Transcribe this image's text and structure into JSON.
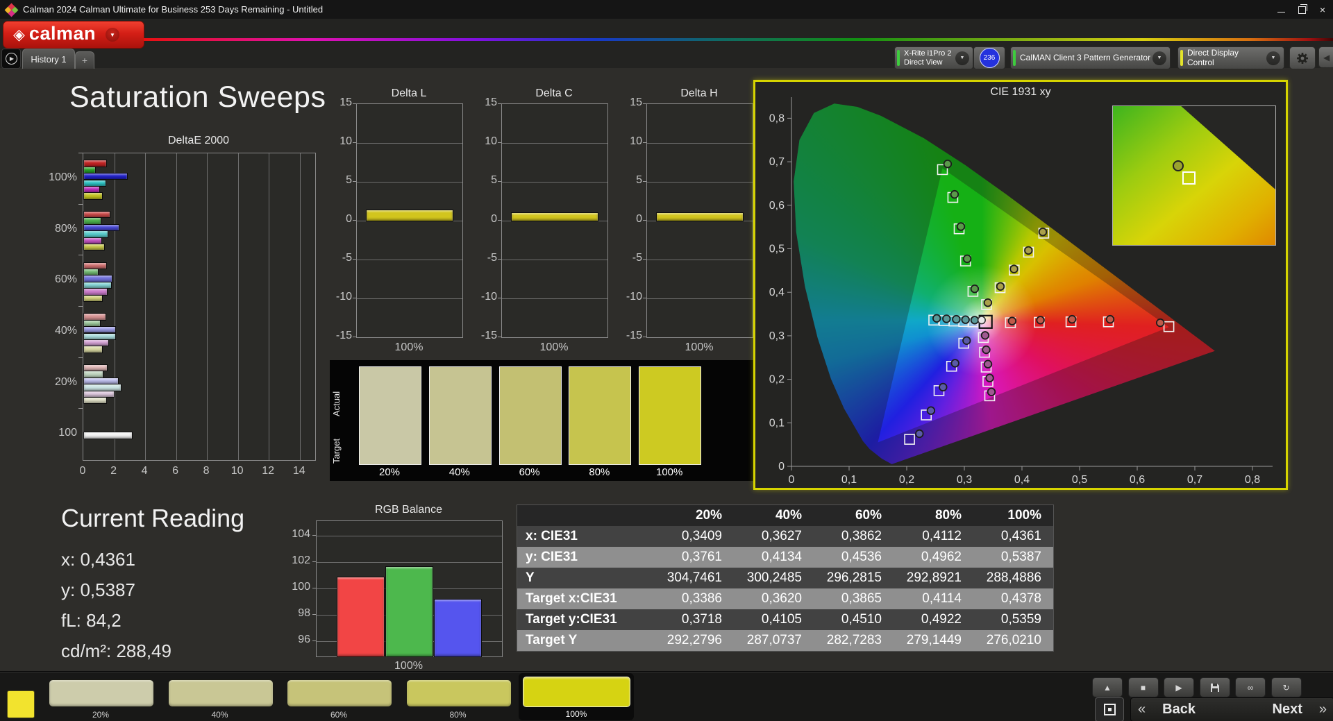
{
  "window": {
    "title": "Calman 2024 Calman Ultimate for Business 253 Days Remaining  - Untitled",
    "controls": {
      "minimize": "minimize",
      "restore": "restore",
      "close": "×"
    }
  },
  "header": {
    "logo_text": "calman",
    "logo_icon": "◈"
  },
  "tabs": {
    "items": [
      "History 1"
    ],
    "add_label": "+"
  },
  "toolbar": {
    "meter": {
      "line1": "X-Rite i1Pro 2",
      "line2": "Direct View",
      "badge": "236",
      "accent": "#3ecb3e",
      "badge_color": "#2431dd"
    },
    "pattern": {
      "label": "CalMAN Client 3 Pattern Generator",
      "accent": "#3ecb3e"
    },
    "display": {
      "label": "Direct Display Control",
      "accent": "#e3e32a"
    }
  },
  "page_title": "Saturation Sweeps",
  "charts": {
    "deltae": {
      "type": "bar",
      "title": "DeltaE 2000",
      "x_ticks": [
        0,
        2,
        4,
        6,
        8,
        10,
        12,
        14
      ],
      "x_max": 15,
      "groups": [
        {
          "label": "100%",
          "values": [
            1.42,
            0.7,
            2.8,
            1.39,
            0.97,
            1.15
          ],
          "colors": [
            "#c22424",
            "#28a428",
            "#2222cc",
            "#2cc4c4",
            "#bc2cbc",
            "#c2c220"
          ]
        },
        {
          "label": "80%",
          "values": [
            1.68,
            1.08,
            2.25,
            1.53,
            1.12,
            1.3
          ],
          "colors": [
            "#cc4949",
            "#4cb04c",
            "#4848d4",
            "#58cccc",
            "#c454c4",
            "#c8c84a"
          ]
        },
        {
          "label": "60%",
          "values": [
            1.42,
            0.9,
            1.8,
            1.77,
            1.47,
            1.15
          ],
          "colors": [
            "#d07070",
            "#74bc74",
            "#7272dc",
            "#84d4d4",
            "#cc7ccc",
            "#d0d078"
          ]
        },
        {
          "label": "40%",
          "values": [
            1.39,
            1.02,
            2.02,
            2.02,
            1.57,
            1.17
          ],
          "colors": [
            "#d89494",
            "#9cc89c",
            "#9a9ae4",
            "#aadcdc",
            "#d4a2d4",
            "#d8d8a2"
          ]
        },
        {
          "label": "20%",
          "values": [
            1.5,
            1.2,
            2.22,
            2.36,
            1.92,
            1.42
          ],
          "colors": [
            "#e0b6b6",
            "#bed4be",
            "#bcbcec",
            "#cce4e4",
            "#dcc6dc",
            "#e0e0c6"
          ]
        },
        {
          "label": "100",
          "values": [
            3.1
          ],
          "colors": [
            "#f2f2f2"
          ]
        }
      ]
    },
    "delta_lch": {
      "type": "bar",
      "ticks": [
        15,
        10,
        5,
        0,
        -5,
        -10,
        -15
      ],
      "range": [
        -15,
        15
      ],
      "x_label": "100%",
      "bar_color": "#d2c51e",
      "panels": [
        {
          "title": "Delta L",
          "value": 1.35
        },
        {
          "title": "Delta C",
          "value": 0.95
        },
        {
          "title": "Delta H",
          "value": 0.95
        }
      ]
    },
    "swatches": {
      "row_labels": [
        "Actual",
        "Target"
      ],
      "items": [
        {
          "label": "20%",
          "color": "#c9c8a6"
        },
        {
          "label": "40%",
          "color": "#c6c492"
        },
        {
          "label": "60%",
          "color": "#c3c072"
        },
        {
          "label": "80%",
          "color": "#c6c44e"
        },
        {
          "label": "100%",
          "color": "#cdca22"
        }
      ]
    },
    "cie": {
      "type": "scatter",
      "title": "CIE 1931 xy",
      "x_ticks": [
        "0",
        "0,1",
        "0,2",
        "0,3",
        "0,4",
        "0,5",
        "0,6",
        "0,7",
        "0,8"
      ],
      "y_ticks": [
        "0",
        "0,1",
        "0,2",
        "0,3",
        "0,4",
        "0,5",
        "0,6",
        "0,7",
        "0,8"
      ],
      "white_point": {
        "square": [
          0.337,
          0.332
        ],
        "circle": [
          0.33,
          0.336
        ]
      },
      "series": [
        {
          "name": "red",
          "dot_color": "#c05a4a",
          "measured": [
            [
              0.383,
              0.334
            ],
            [
              0.432,
              0.336
            ],
            [
              0.487,
              0.338
            ],
            [
              0.553,
              0.338
            ],
            [
              0.64,
              0.33
            ]
          ],
          "target": [
            [
              0.38,
              0.33
            ],
            [
              0.43,
              0.331
            ],
            [
              0.485,
              0.332
            ],
            [
              0.55,
              0.332
            ],
            [
              0.655,
              0.321
            ]
          ]
        },
        {
          "name": "green",
          "dot_color": "#5a9a4a",
          "measured": [
            [
              0.318,
              0.408
            ],
            [
              0.305,
              0.477
            ],
            [
              0.294,
              0.551
            ],
            [
              0.283,
              0.625
            ],
            [
              0.271,
              0.695
            ]
          ],
          "target": [
            [
              0.315,
              0.402
            ],
            [
              0.302,
              0.472
            ],
            [
              0.291,
              0.546
            ],
            [
              0.28,
              0.618
            ],
            [
              0.262,
              0.682
            ]
          ]
        },
        {
          "name": "blue",
          "dot_color": "#5a5aa8",
          "measured": [
            [
              0.304,
              0.289
            ],
            [
              0.284,
              0.237
            ],
            [
              0.263,
              0.182
            ],
            [
              0.242,
              0.128
            ],
            [
              0.222,
              0.075
            ]
          ],
          "target": [
            [
              0.299,
              0.283
            ],
            [
              0.278,
              0.23
            ],
            [
              0.256,
              0.174
            ],
            [
              0.234,
              0.118
            ],
            [
              0.205,
              0.062
            ]
          ]
        },
        {
          "name": "cyan",
          "dot_color": "#5a9a9a",
          "measured": [
            [
              0.318,
              0.336
            ],
            [
              0.302,
              0.337
            ],
            [
              0.286,
              0.338
            ],
            [
              0.269,
              0.339
            ],
            [
              0.252,
              0.34
            ]
          ],
          "target": [
            [
              0.315,
              0.332
            ],
            [
              0.299,
              0.333
            ],
            [
              0.282,
              0.334
            ],
            [
              0.265,
              0.335
            ],
            [
              0.247,
              0.336
            ]
          ]
        },
        {
          "name": "magenta",
          "dot_color": "#a05a92",
          "measured": [
            [
              0.336,
              0.301
            ],
            [
              0.338,
              0.268
            ],
            [
              0.341,
              0.235
            ],
            [
              0.344,
              0.203
            ],
            [
              0.347,
              0.171
            ]
          ],
          "target": [
            [
              0.333,
              0.296
            ],
            [
              0.335,
              0.262
            ],
            [
              0.338,
              0.228
            ],
            [
              0.341,
              0.195
            ],
            [
              0.344,
              0.162
            ]
          ]
        },
        {
          "name": "yellow",
          "dot_color": "#aaa04a",
          "measured": [
            [
              0.3409,
              0.3761
            ],
            [
              0.3627,
              0.4134
            ],
            [
              0.3862,
              0.4536
            ],
            [
              0.4112,
              0.4962
            ],
            [
              0.4361,
              0.5387
            ]
          ],
          "target": [
            [
              0.3386,
              0.3718
            ],
            [
              0.362,
              0.4105
            ],
            [
              0.3865,
              0.451
            ],
            [
              0.4114,
              0.4922
            ],
            [
              0.4378,
              0.5359
            ]
          ]
        }
      ]
    },
    "rgb": {
      "type": "bar",
      "title": "RGB Balance",
      "ticks": [
        104,
        102,
        100,
        98,
        96
      ],
      "range": [
        94.85,
        105.1
      ],
      "x_label": "100%",
      "bars": [
        {
          "name": "red",
          "value": 100.9,
          "color": "#f24545"
        },
        {
          "name": "green",
          "value": 101.7,
          "color": "#4db84d"
        },
        {
          "name": "blue",
          "value": 99.2,
          "color": "#5555ee"
        }
      ]
    }
  },
  "current_reading": {
    "title": "Current Reading",
    "lines": [
      "x: 0,4361",
      "y: 0,5387",
      "fL: 84,2",
      "cd/m²: 288,49"
    ]
  },
  "table": {
    "headers": [
      "20%",
      "40%",
      "60%",
      "80%",
      "100%"
    ],
    "rows": [
      {
        "label": "x: CIE31",
        "shade": "dark",
        "values": [
          "0,3409",
          "0,3627",
          "0,3862",
          "0,4112",
          "0,4361"
        ]
      },
      {
        "label": "y: CIE31",
        "shade": "light",
        "values": [
          "0,3761",
          "0,4134",
          "0,4536",
          "0,4962",
          "0,5387"
        ]
      },
      {
        "label": "Y",
        "shade": "dark",
        "values": [
          "304,7461",
          "300,2485",
          "296,2815",
          "292,8921",
          "288,4886"
        ]
      },
      {
        "label": "Target x:CIE31",
        "shade": "light",
        "values": [
          "0,3386",
          "0,3620",
          "0,3865",
          "0,4114",
          "0,4378"
        ]
      },
      {
        "label": "Target y:CIE31",
        "shade": "dark",
        "values": [
          "0,3718",
          "0,4105",
          "0,4510",
          "0,4922",
          "0,5359"
        ]
      },
      {
        "label": "Target Y",
        "shade": "light",
        "values": [
          "292,2796",
          "287,0737",
          "282,7283",
          "279,1449",
          "276,0210"
        ]
      }
    ]
  },
  "bottombar": {
    "color_chip": "#f2e32e",
    "swatches": [
      {
        "label": "20%",
        "color": "#cdccab"
      },
      {
        "label": "40%",
        "color": "#c9c795"
      },
      {
        "label": "60%",
        "color": "#c6c379"
      },
      {
        "label": "80%",
        "color": "#c9c75e"
      },
      {
        "label": "100%",
        "color": "#d6d312"
      }
    ],
    "selected_index": 4,
    "nav": {
      "back": "Back",
      "next": "Next",
      "prev_icon": "«",
      "next_icon": "»"
    },
    "tools": [
      "eject",
      "stop",
      "play",
      "save",
      "loop",
      "refresh"
    ]
  }
}
